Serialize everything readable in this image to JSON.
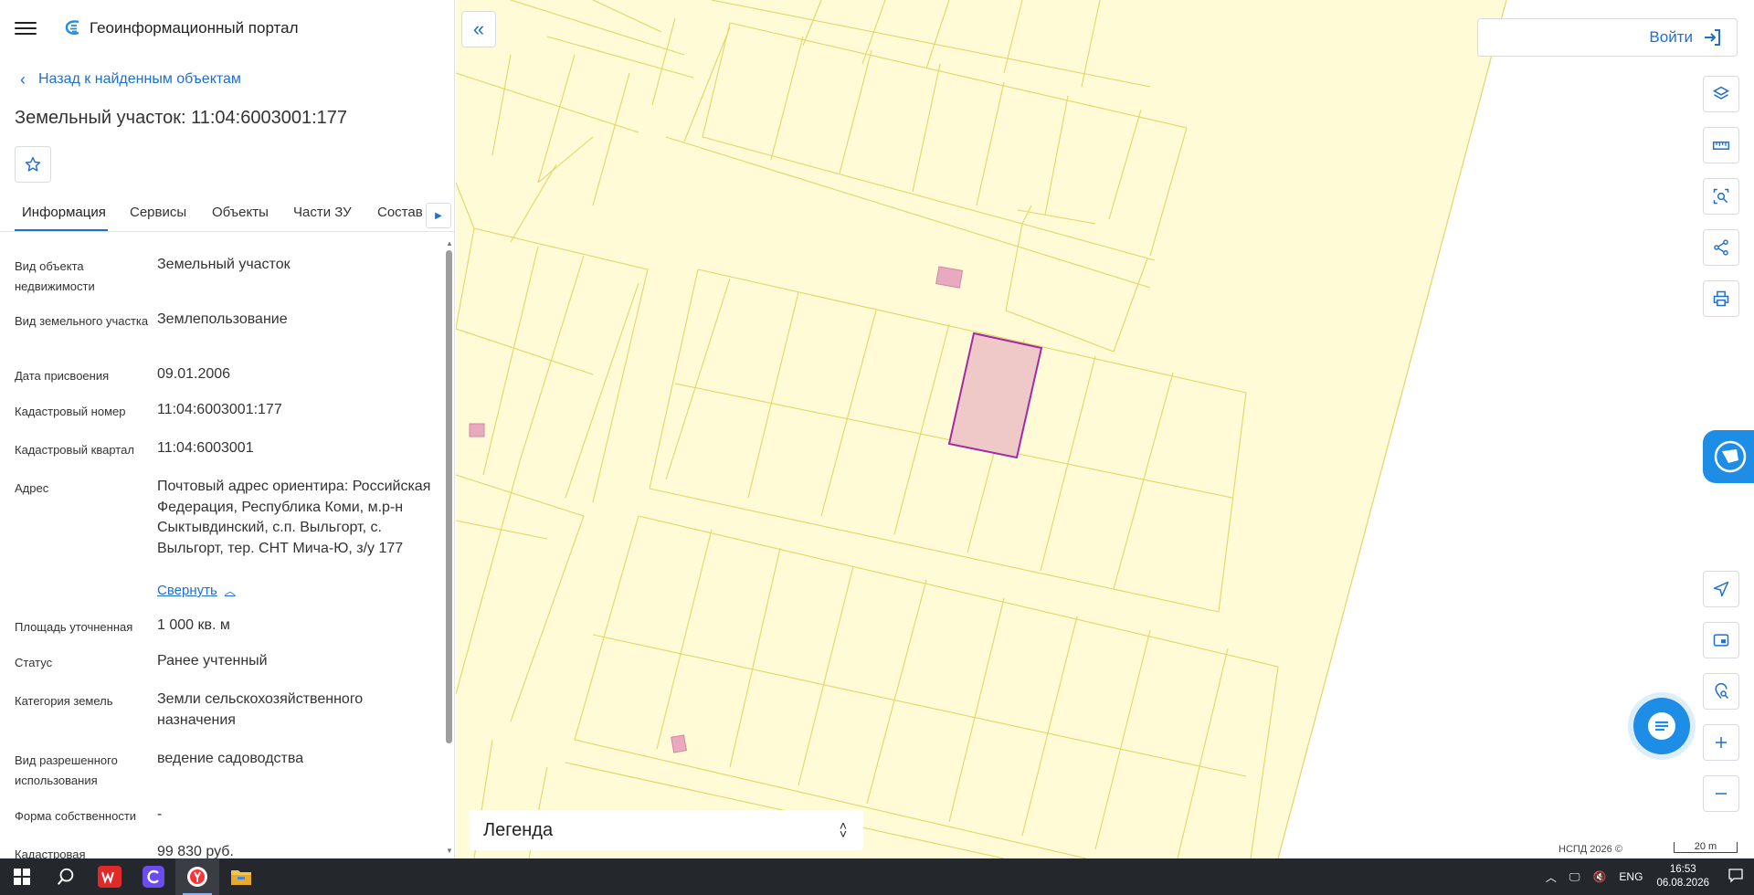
{
  "app": {
    "title": "Геоинформационный портал"
  },
  "nav": {
    "back_label": "Назад к найденным объектам"
  },
  "object": {
    "title": "Земельный участок: 11:04:6003001:177"
  },
  "tabs": [
    "Информация",
    "Сервисы",
    "Объекты",
    "Части ЗУ",
    "Состав"
  ],
  "properties": [
    {
      "label": "Вид объекта недвижимости",
      "value": "Земельный участок"
    },
    {
      "label": "Вид земельного участка",
      "value": "Землепользование"
    },
    {
      "label": "Дата присвоения",
      "value": "09.01.2006"
    },
    {
      "label": "Кадастровый номер",
      "value": "11:04:6003001:177"
    },
    {
      "label": "Кадастровый квартал",
      "value": "11:04:6003001"
    },
    {
      "label": "Адрес",
      "value": "Почтовый адрес ориентира: Российская Федерация, Республика Коми, м.р-н Сыктывдинский, с.п. Выльгорт, с. Выльгорт, тер. СНТ Мича-Ю, з/у 177"
    },
    {
      "label": "Площадь уточненная",
      "value": "1 000 кв. м"
    },
    {
      "label": "Статус",
      "value": "Ранее учтенный"
    },
    {
      "label": "Категория земель",
      "value": "Земли сельскохозяйственного назначения"
    },
    {
      "label": "Вид разрешенного использования",
      "value": "ведение садоводства"
    },
    {
      "label": "Форма собственности",
      "value": "-"
    },
    {
      "label": "Кадастровая",
      "value": "99 830 руб."
    }
  ],
  "collapse_label": "Свернуть",
  "map": {
    "login_label": "Войти",
    "legend_label": "Легенда",
    "copyright": "НСПД 2026 ©",
    "scale_label": "20 m",
    "colors": {
      "parcel_fill": "#fefbd6",
      "parcel_line": "#e4d56a",
      "selected": "#a22aa5",
      "building": "#e9a9be"
    }
  },
  "taskbar": {
    "apps": [
      "windows-start",
      "search",
      "wps-office",
      "app-c",
      "yandex-browser",
      "file-explorer"
    ],
    "lang": "ENG",
    "time": "16:53",
    "date": "06.08.2026"
  }
}
